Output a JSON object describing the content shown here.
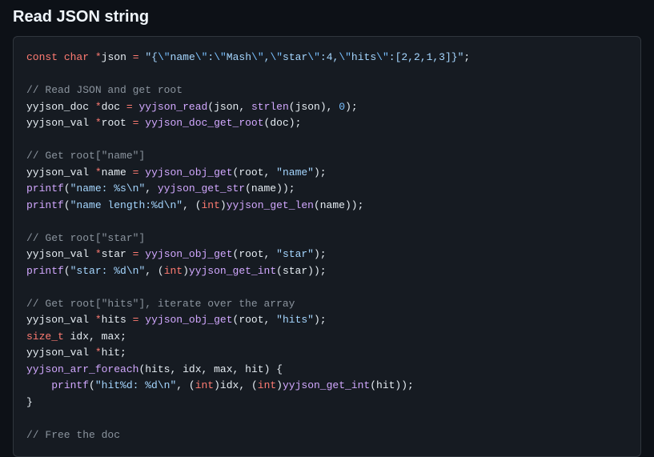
{
  "heading": "Read JSON string",
  "code": {
    "json_literal_open": "\"{",
    "json_literal_close": "}\"",
    "kw_const": "const",
    "kw_char": "char",
    "kw_int": "int",
    "star": "*",
    "assign": "=",
    "semi": ";",
    "comma": ",",
    "lparen": "(",
    "rparen": ")",
    "lbrace": "{",
    "rbrace": "}",
    "id_json": "json",
    "id_doc": "doc",
    "id_root": "root",
    "id_name": "name",
    "id_star": "star",
    "id_hits": "hits",
    "id_hit": "hit",
    "id_idx": "idx",
    "id_max": "max",
    "t_yyjson_doc": "yyjson_doc",
    "t_yyjson_val": "yyjson_val",
    "t_size_t": "size_t",
    "fn_yyjson_read": "yyjson_read",
    "fn_strlen": "strlen",
    "fn_yyjson_doc_get_root": "yyjson_doc_get_root",
    "fn_yyjson_obj_get": "yyjson_obj_get",
    "fn_printf": "printf",
    "fn_yyjson_get_str": "yyjson_get_str",
    "fn_yyjson_get_len": "yyjson_get_len",
    "fn_yyjson_get_int": "yyjson_get_int",
    "fn_yyjson_arr_foreach": "yyjson_arr_foreach",
    "esc_q": "\\\"",
    "lit_name": "name",
    "esc_colon": ":",
    "lit_Mash": "Mash",
    "lit_star": "star",
    "lit_4": "4",
    "lit_hits": "hits",
    "lit_arr": "[2,2,1,3]",
    "num_0": "0",
    "str_name": "\"name\"",
    "str_star": "\"star\"",
    "str_hits": "\"hits\"",
    "fmt_name": "\"name: %s\\n\"",
    "fmt_namelen": "\"name length:%d\\n\"",
    "fmt_star": "\"star: %d\\n\"",
    "fmt_hit": "\"hit%d: %d\\n\"",
    "cm_read_root": "// Read JSON and get root",
    "cm_get_name": "// Get root[\"name\"]",
    "cm_get_star": "// Get root[\"star\"]",
    "cm_get_hits": "// Get root[\"hits\"], iterate over the array",
    "cm_free": "// Free the doc"
  }
}
